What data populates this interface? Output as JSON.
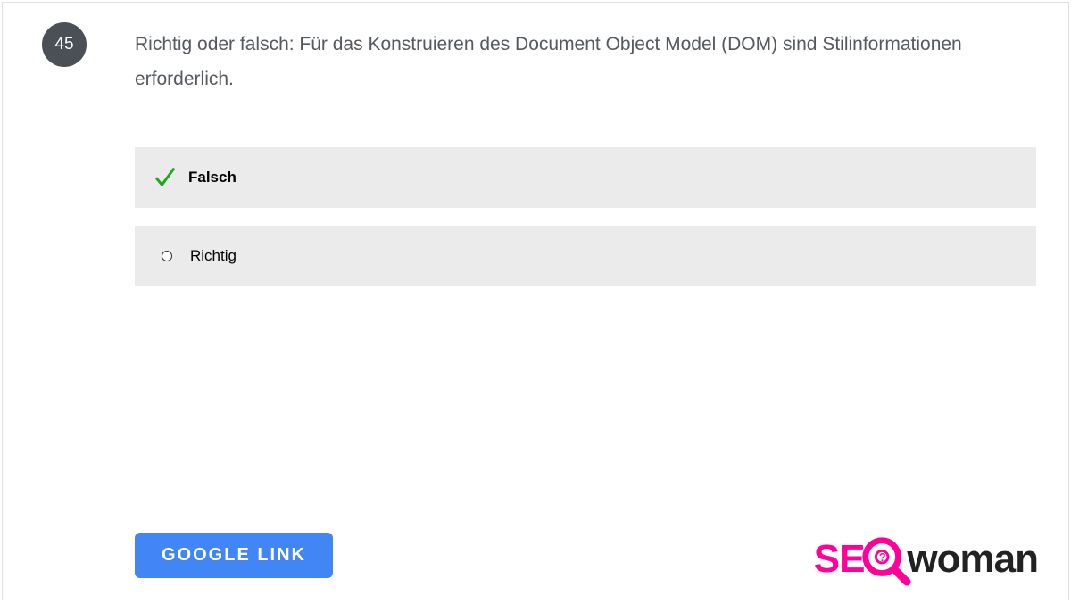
{
  "question": {
    "number": "45",
    "text": "Richtig oder falsch: Für das Konstruieren des Document Object Model (DOM) sind Stilinformationen erforderlich."
  },
  "answers": [
    {
      "label": "Falsch",
      "correct": true
    },
    {
      "label": "Richtig",
      "correct": false
    }
  ],
  "button": {
    "label": "GOOGLE   LINK"
  },
  "logo": {
    "part1": "SE",
    "part2": "woman"
  }
}
